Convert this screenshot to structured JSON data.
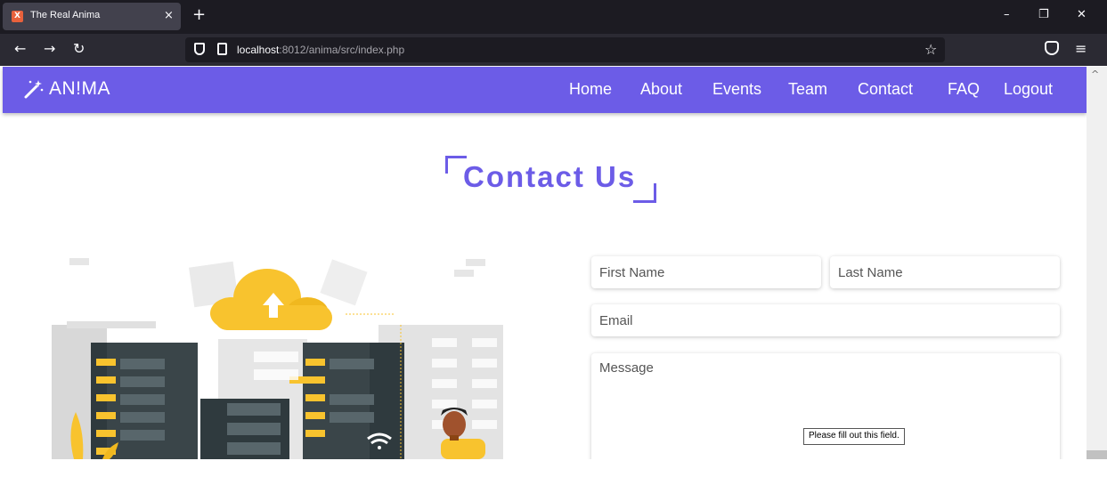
{
  "browser": {
    "tab_title": "The Real Anima",
    "tab_close": "×",
    "new_tab": "+",
    "url_host": "localhost",
    "url_rest": ":8012/anima/src/index.php",
    "window_controls": [
      "–",
      "❐",
      "✕"
    ],
    "nav_icons": [
      "back-arrow-icon",
      "forward-arrow-icon",
      "reload-icon"
    ]
  },
  "site": {
    "logo_text": "AN!MA",
    "accent_color": "#6c5ce7",
    "menu": [
      "Home",
      "About",
      "Events",
      "Team",
      "Contact",
      "FAQ",
      "Logout"
    ]
  },
  "contact": {
    "heading": "Contact Us",
    "first_name_placeholder": "First Name",
    "last_name_placeholder": "Last Name",
    "email_placeholder": "Email",
    "message_placeholder": "Message",
    "validation_tooltip": "Please fill out this field."
  }
}
